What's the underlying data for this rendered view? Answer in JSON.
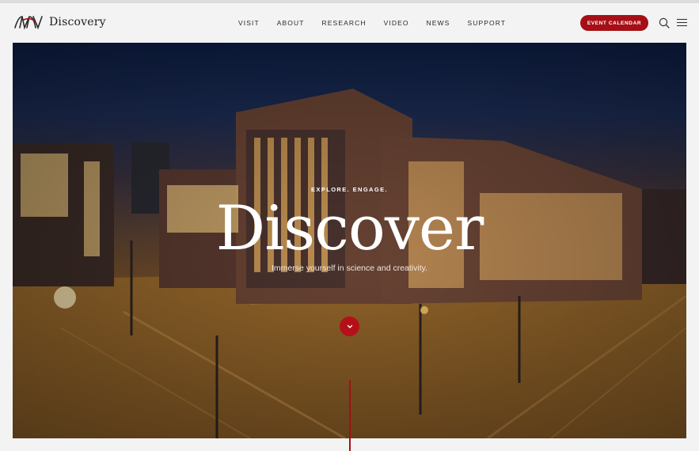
{
  "brand": {
    "name": "Discovery",
    "logo_icon": "monogram-logo"
  },
  "nav": [
    {
      "label": "VISIT"
    },
    {
      "label": "ABOUT"
    },
    {
      "label": "RESEARCH"
    },
    {
      "label": "VIDEO"
    },
    {
      "label": "NEWS"
    },
    {
      "label": "SUPPORT"
    }
  ],
  "header": {
    "cta_label": "EVENT CALENDAR",
    "search_icon": "search-icon",
    "menu_icon": "hamburger-menu-icon"
  },
  "hero": {
    "eyebrow": "EXPLORE. ENGAGE.",
    "headline": "Discover",
    "tagline": "Immerse yourself in science and creativity.",
    "scroll_icon": "chevron-down-icon"
  },
  "colors": {
    "accent": "#a50f15",
    "background": "#f3f3f3",
    "text": "#2a2a2a"
  }
}
